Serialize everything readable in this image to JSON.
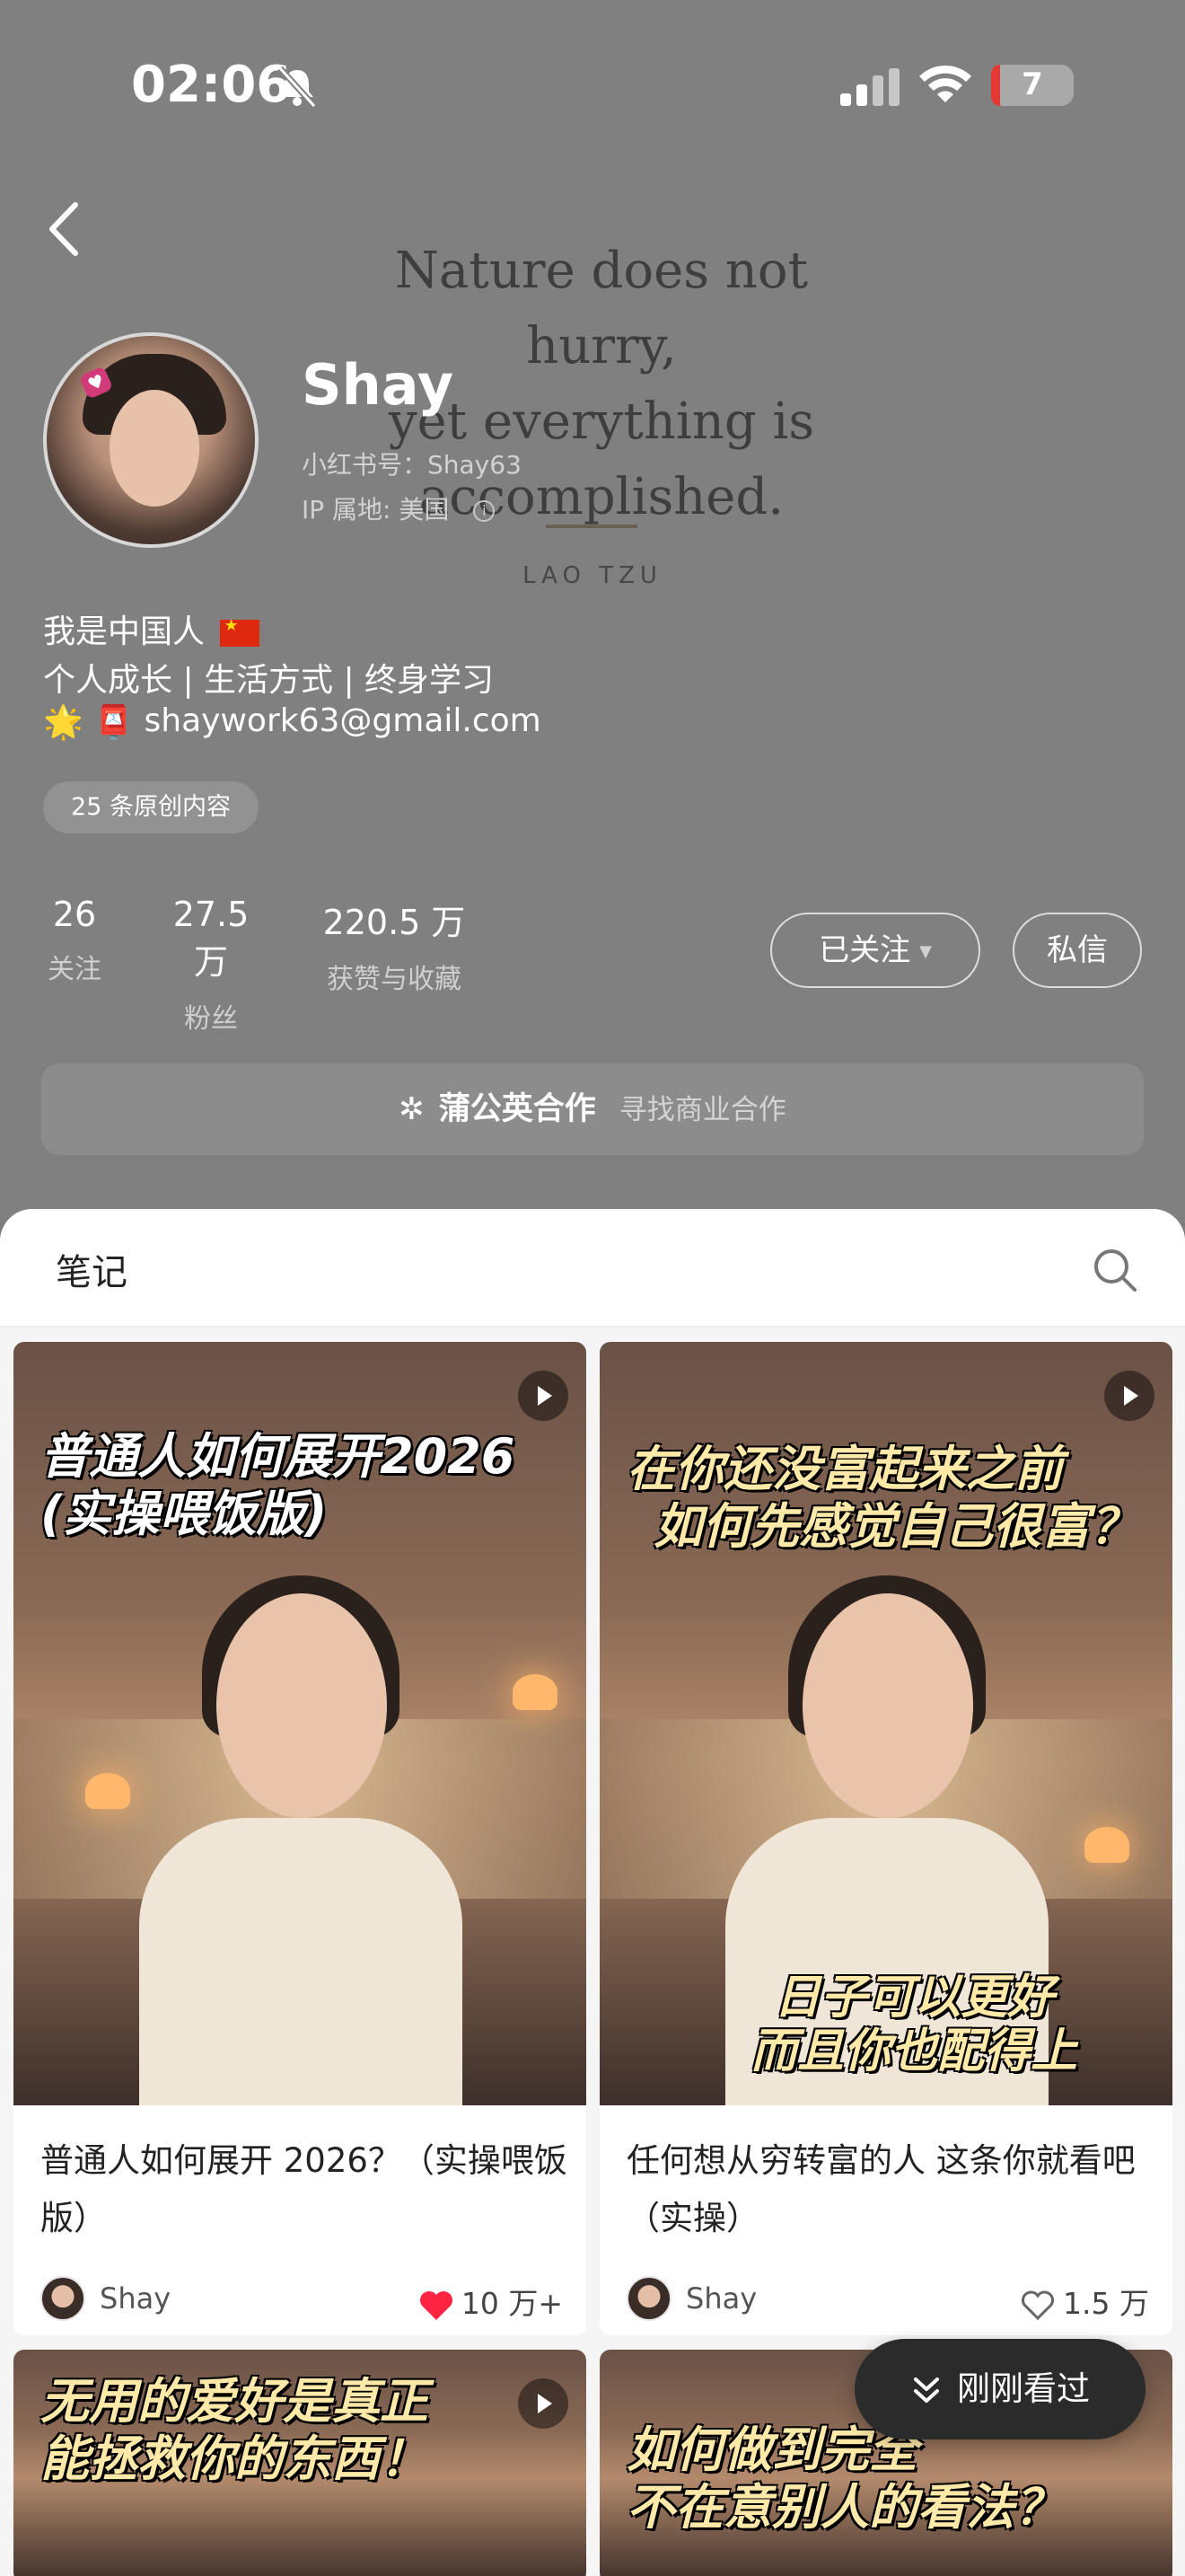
{
  "status_bar": {
    "time": "02:06",
    "battery": "7"
  },
  "banner": {
    "quote": [
      "Nature does not hurry,",
      "yet everything is",
      "accomplished."
    ],
    "author": "LAO TZU"
  },
  "profile": {
    "name": "Shay",
    "id_line": "小红书号：Shay63",
    "ip_line": "IP 属地: 美国",
    "info_icon": "ⓘ",
    "bio_line1": "我是中国人",
    "bio_line2": "个人成长 | 生活方式 | 终身学习",
    "bio_line3_prefix": "🌟 📮",
    "bio_email": "shaywork63@gmail.com",
    "original_count": "25 条原创内容"
  },
  "stats": [
    {
      "value": "26",
      "label": "关注"
    },
    {
      "value": "27.5 万",
      "label": "粉丝"
    },
    {
      "value": "220.5 万",
      "label": "获赞与收藏"
    }
  ],
  "actions": {
    "follow_label": "已关注",
    "dm_label": "私信"
  },
  "cooperation": {
    "title": "蒲公英合作",
    "subtitle": "寻找商业合作"
  },
  "notes_section": {
    "title": "笔记"
  },
  "notes": [
    {
      "thumb_caption": [
        "普通人如何展开2026",
        "(实操喂饭版)"
      ],
      "title": "普通人如何展开 2026？（实操喂饭版）",
      "author": "Shay",
      "likes": "10 万+",
      "liked": true
    },
    {
      "thumb_caption": [
        "在你还没富起来之前",
        "如何先感觉自己很富？"
      ],
      "thumb_caption_bottom": [
        "日子可以更好",
        "而且你也配得上"
      ],
      "title": "任何想从穷转富的人 这条你就看吧（实操）",
      "author": "Shay",
      "likes": "1.5 万",
      "liked": false
    },
    {
      "thumb_caption": [
        "无用的爱好是真正",
        "能拯救你的东西！"
      ]
    },
    {
      "thumb_caption": [
        "如何做到完全",
        "不在意别人的看法？"
      ]
    }
  ],
  "recently_viewed": "刚刚看过",
  "colors": {
    "like_red": "#ff2442",
    "panel_bg": "#f5f5f5",
    "header_bg": "#808080"
  }
}
